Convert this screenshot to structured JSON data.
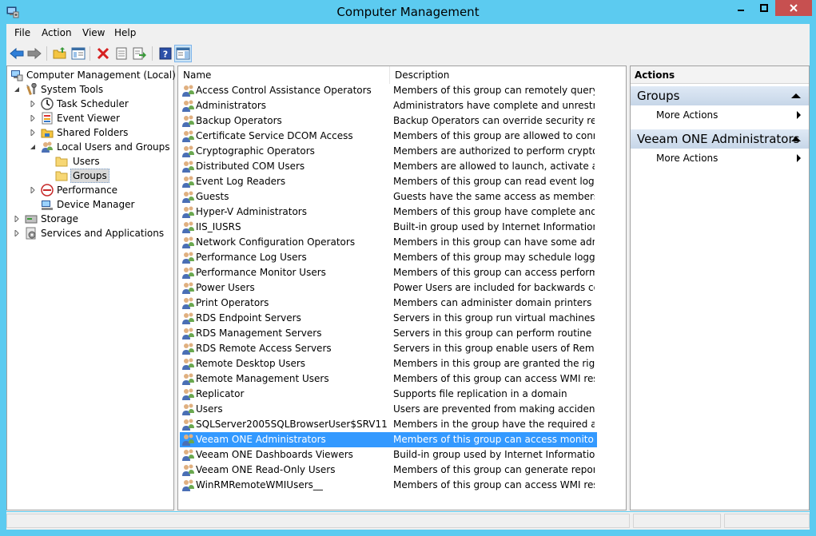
{
  "window": {
    "title": "Computer Management"
  },
  "menu": [
    "File",
    "Action",
    "View",
    "Help"
  ],
  "toolbar": {
    "icons": [
      "back-icon",
      "forward-icon",
      "up-folder-icon",
      "show-hide-tree-icon",
      "delete-icon",
      "properties-icon",
      "export-list-icon",
      "help-icon",
      "action-pane-icon"
    ]
  },
  "tree": [
    {
      "label": "Computer Management (Local)",
      "level": 0,
      "icon": "computer-management-icon",
      "expander": "none"
    },
    {
      "label": "System Tools",
      "level": 1,
      "icon": "system-tools-icon",
      "expander": "expanded"
    },
    {
      "label": "Task Scheduler",
      "level": 2,
      "icon": "clock-icon",
      "expander": "collapsed"
    },
    {
      "label": "Event Viewer",
      "level": 2,
      "icon": "event-viewer-icon",
      "expander": "collapsed"
    },
    {
      "label": "Shared Folders",
      "level": 2,
      "icon": "shared-folders-icon",
      "expander": "collapsed"
    },
    {
      "label": "Local Users and Groups",
      "level": 2,
      "icon": "users-groups-icon",
      "expander": "expanded"
    },
    {
      "label": "Users",
      "level": 3,
      "icon": "folder-icon",
      "expander": "none"
    },
    {
      "label": "Groups",
      "level": 3,
      "icon": "folder-icon",
      "expander": "none",
      "selected": true
    },
    {
      "label": "Performance",
      "level": 2,
      "icon": "performance-icon",
      "expander": "collapsed"
    },
    {
      "label": "Device Manager",
      "level": 2,
      "icon": "device-manager-icon",
      "expander": "none"
    },
    {
      "label": "Storage",
      "level": 1,
      "icon": "storage-icon",
      "expander": "collapsed"
    },
    {
      "label": "Services and Applications",
      "level": 1,
      "icon": "services-icon",
      "expander": "collapsed"
    }
  ],
  "list": {
    "columns": [
      "Name",
      "Description"
    ],
    "rows": [
      {
        "name": "Access Control Assistance Operators",
        "desc": "Members of this group can remotely query a..."
      },
      {
        "name": "Administrators",
        "desc": "Administrators have complete and unrestrict..."
      },
      {
        "name": "Backup Operators",
        "desc": "Backup Operators can override security restri..."
      },
      {
        "name": "Certificate Service DCOM Access",
        "desc": "Members of this group are allowed to conne..."
      },
      {
        "name": "Cryptographic Operators",
        "desc": "Members are authorized to perform cryptogr..."
      },
      {
        "name": "Distributed COM Users",
        "desc": "Members are allowed to launch, activate and..."
      },
      {
        "name": "Event Log Readers",
        "desc": "Members of this group can read event logs fr..."
      },
      {
        "name": "Guests",
        "desc": "Guests have the same access as members of ..."
      },
      {
        "name": "Hyper-V Administrators",
        "desc": "Members of this group have complete and u..."
      },
      {
        "name": "IIS_IUSRS",
        "desc": "Built-in group used by Internet Information S..."
      },
      {
        "name": "Network Configuration Operators",
        "desc": "Members in this group can have some admi..."
      },
      {
        "name": "Performance Log Users",
        "desc": "Members of this group may schedule loggin..."
      },
      {
        "name": "Performance Monitor Users",
        "desc": "Members of this group can access performa..."
      },
      {
        "name": "Power Users",
        "desc": "Power Users are included for backwards com..."
      },
      {
        "name": "Print Operators",
        "desc": "Members can administer domain printers"
      },
      {
        "name": "RDS Endpoint Servers",
        "desc": "Servers in this group run virtual machines an..."
      },
      {
        "name": "RDS Management Servers",
        "desc": "Servers in this group can perform routine ad..."
      },
      {
        "name": "RDS Remote Access Servers",
        "desc": "Servers in this group enable users of Remote..."
      },
      {
        "name": "Remote Desktop Users",
        "desc": "Members in this group are granted the right t..."
      },
      {
        "name": "Remote Management Users",
        "desc": "Members of this group can access WMI reso..."
      },
      {
        "name": "Replicator",
        "desc": "Supports file replication in a domain"
      },
      {
        "name": "Users",
        "desc": "Users are prevented from making accidental ..."
      },
      {
        "name": "SQLServer2005SQLBrowserUser$SRV11",
        "desc": "Members in the group have the required acc..."
      },
      {
        "name": "Veeam ONE Administrators",
        "desc": "Members of this group can access monitorin...",
        "selected": true
      },
      {
        "name": "Veeam ONE Dashboards Viewers",
        "desc": "Build-in group used by Internet Information ..."
      },
      {
        "name": "Veeam ONE Read-Only Users",
        "desc": "Members of this group can generate reports ..."
      },
      {
        "name": "WinRMRemoteWMIUsers__",
        "desc": "Members of this group can access WMI reso..."
      }
    ]
  },
  "actions": {
    "title": "Actions",
    "sections": [
      {
        "title": "Groups",
        "items": [
          "More Actions"
        ]
      },
      {
        "title": "Veeam ONE Administrators",
        "items": [
          "More Actions"
        ]
      }
    ]
  },
  "colors": {
    "window_frame": "#5ccbf0",
    "selection": "#3399ff",
    "close_button": "#c75050"
  }
}
